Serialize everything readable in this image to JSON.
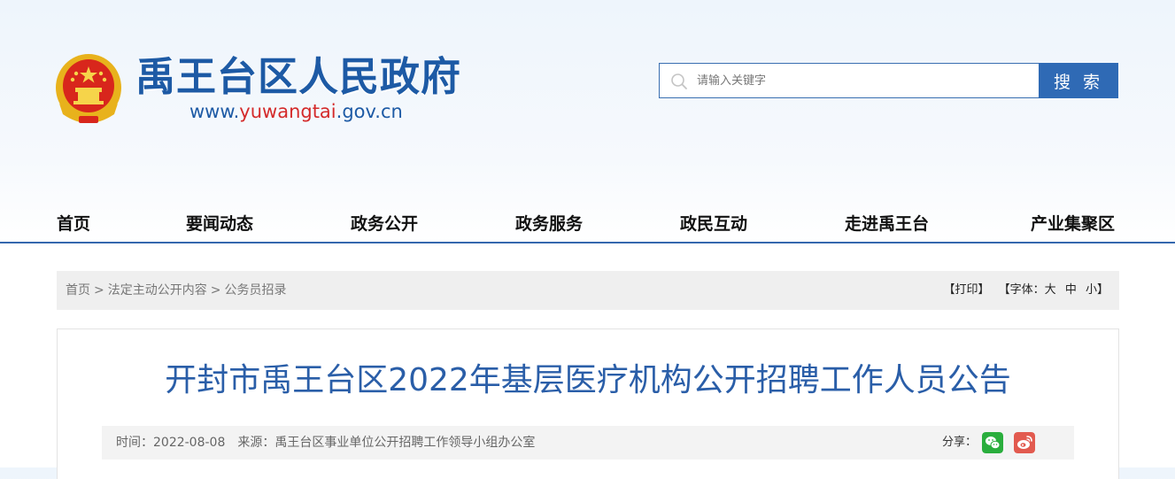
{
  "header": {
    "site_title": "禹王台区人民政府",
    "url_prefix": "www.",
    "url_highlight": "yuwangtai",
    "url_suffix": ".gov.cn",
    "emblem_icon": "national-emblem-icon"
  },
  "search": {
    "placeholder": "请输入关键字",
    "button_label": "搜 索",
    "icon": "search-icon"
  },
  "nav": {
    "items": [
      {
        "label": "首页"
      },
      {
        "label": "要闻动态"
      },
      {
        "label": "政务公开"
      },
      {
        "label": "政务服务"
      },
      {
        "label": "政民互动"
      },
      {
        "label": "走进禹王台"
      },
      {
        "label": "产业集聚区"
      }
    ]
  },
  "breadcrumb": {
    "items": [
      "首页",
      "法定主动公开内容",
      "公务员招录"
    ],
    "separator": ">"
  },
  "tools": {
    "print": "【打印】",
    "font_prefix": "【字体：",
    "font_large": "大",
    "font_medium": "中",
    "font_small": "小",
    "font_suffix": "】"
  },
  "article": {
    "title": "开封市禹王台区2022年基层医疗机构公开招聘工作人员公告",
    "time_label": "时间：",
    "time_value": "2022-08-08",
    "source_label": "来源：",
    "source_value": "禹王台区事业单位公开招聘工作领导小组办公室",
    "share_label": "分享：",
    "share_icons": [
      "wechat-icon",
      "weibo-icon"
    ]
  },
  "colors": {
    "brand_blue": "#1d5aa5",
    "url_red": "#d42a2a",
    "search_button": "#2f6ab5",
    "nav_line": "#3568ae",
    "title_blue": "#2a5ea8",
    "wechat_green": "#2aae3d",
    "weibo_red": "#e25a4f"
  }
}
